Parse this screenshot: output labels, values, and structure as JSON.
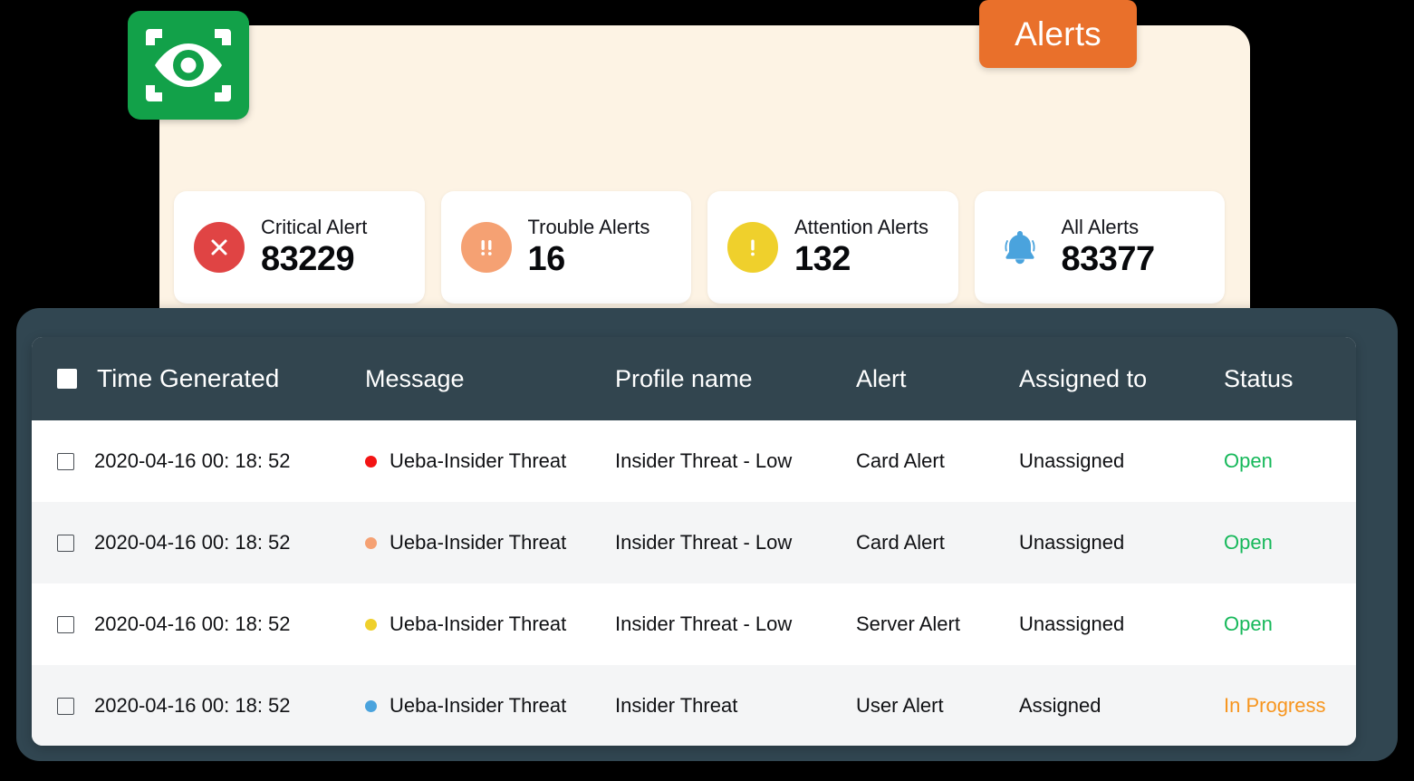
{
  "brand": {
    "logo_icon": "eye-scanner-icon",
    "logo_color": "#12a149"
  },
  "tab": {
    "label": "Alerts",
    "color": "#e9702b"
  },
  "panel": {
    "background": "#fdf3e4"
  },
  "stat_cards": [
    {
      "label": "Critical Alert",
      "value": "83229",
      "icon": "circle-x-icon",
      "color": "#e04444"
    },
    {
      "label": "Trouble Alerts",
      "value": "16",
      "icon": "double-exclamation-icon",
      "color": "#f5a173"
    },
    {
      "label": "Attention Alerts",
      "value": "132",
      "icon": "exclamation-circle-icon",
      "color": "#efd02c"
    },
    {
      "label": "All Alerts",
      "value": "83377",
      "icon": "bell-icon",
      "color": "#4aa3dd"
    }
  ],
  "table": {
    "header_background": "#32454f",
    "columns": [
      {
        "key": "time",
        "label": "Time Generated"
      },
      {
        "key": "message",
        "label": "Message"
      },
      {
        "key": "profile",
        "label": "Profile name"
      },
      {
        "key": "alert",
        "label": "Alert"
      },
      {
        "key": "assign",
        "label": "Assigned to"
      },
      {
        "key": "status",
        "label": "Status"
      }
    ],
    "rows": [
      {
        "time": "2020-04-16 00: 18: 52",
        "dot_color": "#f31414",
        "message": "Ueba-Insider  Threat",
        "profile": "Insider Threat - Low",
        "alert": "Card Alert",
        "assign": "Unassigned",
        "status": "Open",
        "status_color": "#16b85a"
      },
      {
        "time": "2020-04-16 00: 18: 52",
        "dot_color": "#f5a173",
        "message": "Ueba-Insider  Threat",
        "profile": "Insider Threat - Low",
        "alert": "Card Alert",
        "assign": "Unassigned",
        "status": "Open",
        "status_color": "#16b85a"
      },
      {
        "time": "2020-04-16 00: 18: 52",
        "dot_color": "#efd02c",
        "message": "Ueba-Insider  Threat",
        "profile": "Insider Threat - Low",
        "alert": "Server Alert",
        "assign": "Unassigned",
        "status": "Open",
        "status_color": "#16b85a"
      },
      {
        "time": "2020-04-16 00: 18: 52",
        "dot_color": "#4aa3dd",
        "message": "Ueba-Insider  Threat",
        "profile": "Insider Threat",
        "alert": "User Alert",
        "assign": "Assigned",
        "status": "In Progress",
        "status_color": "#f7951e"
      }
    ]
  }
}
